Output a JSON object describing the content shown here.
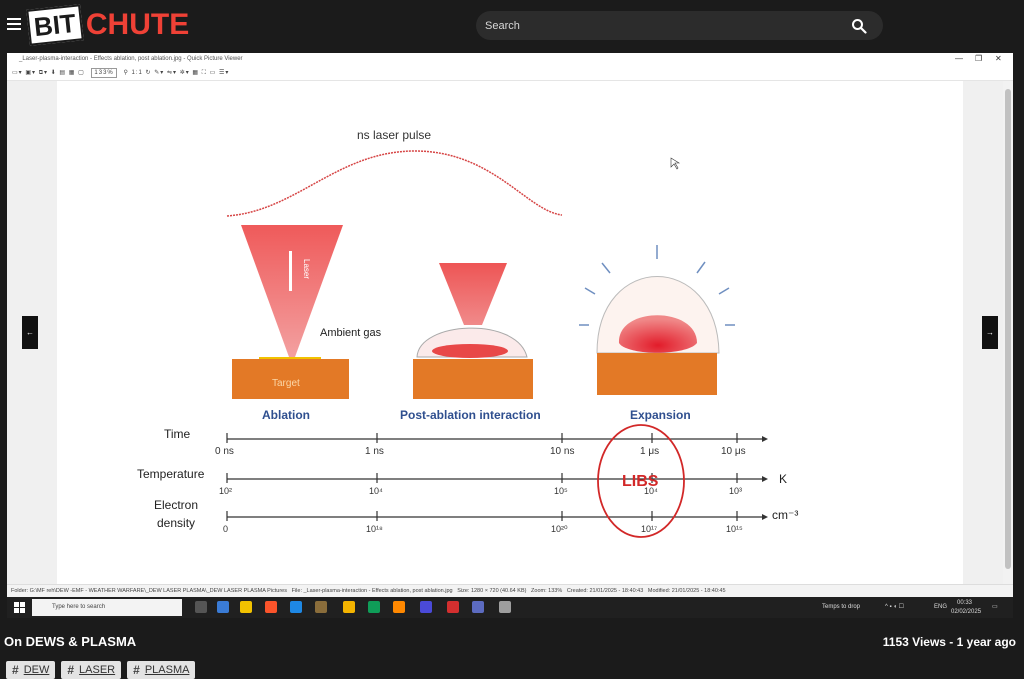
{
  "site": {
    "logo_bit": "BIT",
    "logo_chute": "CHUTE",
    "brand_color": "#ef4136"
  },
  "search": {
    "placeholder": "Search"
  },
  "viewer": {
    "title": "_Laser-plasma-interaction - Effects ablation, post ablation.jpg - Quick Picture Viewer",
    "zoom": "133%",
    "ratio": "1:1",
    "status_folder": "Folder: G:\\MF reh\\DEW -EMF - WEATHER WARFARE\\_DEW LASER PLASMA\\_DEW LASER PLASMA Pictures",
    "status_file": "File: _Laser-plasma-interaction - Effects ablation, post ablation.jpg",
    "status_size": "Size: 1280 × 720 (40.64 KB)",
    "status_zoom": "Zoom: 133%",
    "status_created": "Created: 21/01/2025 - 18:40:43",
    "status_modified": "Modified: 21/01/2025 - 18:40:45"
  },
  "diagram": {
    "pulse_label": "ns laser pulse",
    "laser_label": "Laser",
    "ambient_label": "Ambient gas",
    "target_label": "Target",
    "stage1": "Ablation",
    "stage2": "Post-ablation interaction",
    "stage3": "Expansion",
    "time_label": "Time",
    "temp_label": "Temperature",
    "density_label_1": "Electron",
    "density_label_2": "density",
    "time_ticks": [
      "0 ns",
      "1 ns",
      "10 ns",
      "1 μs",
      "10 μs"
    ],
    "temp_ticks": [
      "10²",
      "10⁴",
      "10⁵",
      "10⁴",
      "10³"
    ],
    "temp_unit": "K",
    "density_ticks": [
      "0",
      "10¹⁸",
      "10²⁰",
      "10¹⁷",
      "10¹⁵"
    ],
    "density_unit": "cm⁻³",
    "libs_label": "LIBS"
  },
  "taskbar": {
    "search_placeholder": "Type here to search",
    "weather": "Temps to drop",
    "lang": "ENG",
    "time": "00:33",
    "date": "02/02/2025"
  },
  "video": {
    "title": "On DEWS & PLASMA",
    "stats": "1153 Views - 1 year ago"
  },
  "tags": [
    "DEW",
    "LASER",
    "PLASMA"
  ]
}
